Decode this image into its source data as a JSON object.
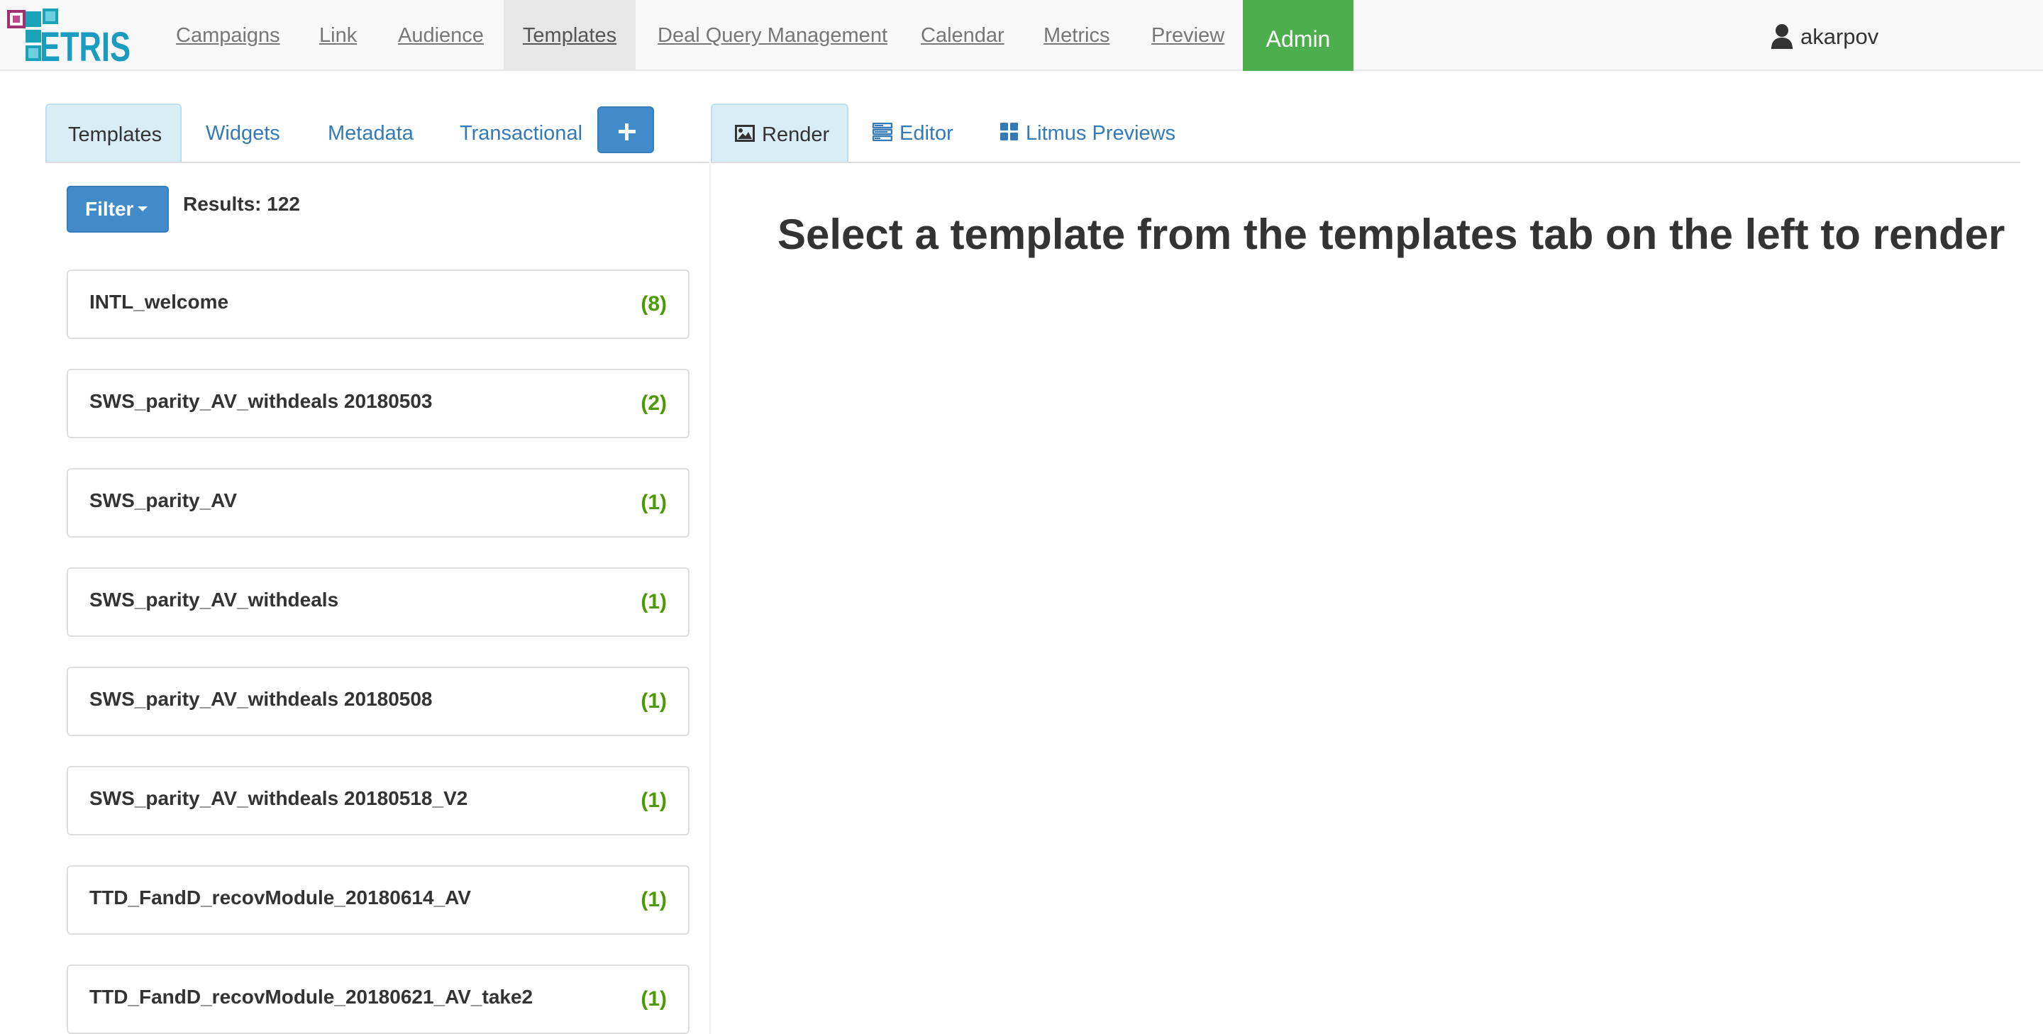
{
  "app": {
    "logo_text": "ETRIS"
  },
  "nav": {
    "items": [
      {
        "label": "Campaigns"
      },
      {
        "label": "Link"
      },
      {
        "label": "Audience"
      },
      {
        "label": "Templates"
      },
      {
        "label": "Deal Query Management"
      },
      {
        "label": "Calendar"
      },
      {
        "label": "Metrics"
      },
      {
        "label": "Preview"
      }
    ],
    "admin_label": "Admin",
    "active": "Templates",
    "user": "akarpov"
  },
  "left_tabs": {
    "items": [
      {
        "label": "Templates"
      },
      {
        "label": "Widgets"
      },
      {
        "label": "Metadata"
      },
      {
        "label": "Transactional"
      }
    ],
    "active": "Templates"
  },
  "right_tabs": {
    "items": [
      {
        "label": "Render",
        "icon": "image-icon"
      },
      {
        "label": "Editor",
        "icon": "tasks-icon"
      },
      {
        "label": "Litmus Previews",
        "icon": "grid-icon"
      }
    ],
    "active": "Render"
  },
  "filter": {
    "label": "Filter",
    "results": "Results: 122"
  },
  "templates": [
    {
      "name": "INTL_welcome",
      "count": "(8)"
    },
    {
      "name": "SWS_parity_AV_withdeals 20180503",
      "count": "(2)"
    },
    {
      "name": "SWS_parity_AV",
      "count": "(1)"
    },
    {
      "name": "SWS_parity_AV_withdeals",
      "count": "(1)"
    },
    {
      "name": "SWS_parity_AV_withdeals 20180508",
      "count": "(1)"
    },
    {
      "name": "SWS_parity_AV_withdeals 20180518_V2",
      "count": "(1)"
    },
    {
      "name": "TTD_FandD_recovModule_20180614_AV",
      "count": "(1)"
    },
    {
      "name": "TTD_FandD_recovModule_20180621_AV_take2",
      "count": "(1)"
    }
  ],
  "render": {
    "message": "Select a template from the templates tab on the left to render"
  },
  "colors": {
    "accent": "#428bca",
    "admin": "#4cae4c",
    "count": "#4e9a06",
    "active_tab": "#d9edf7"
  }
}
